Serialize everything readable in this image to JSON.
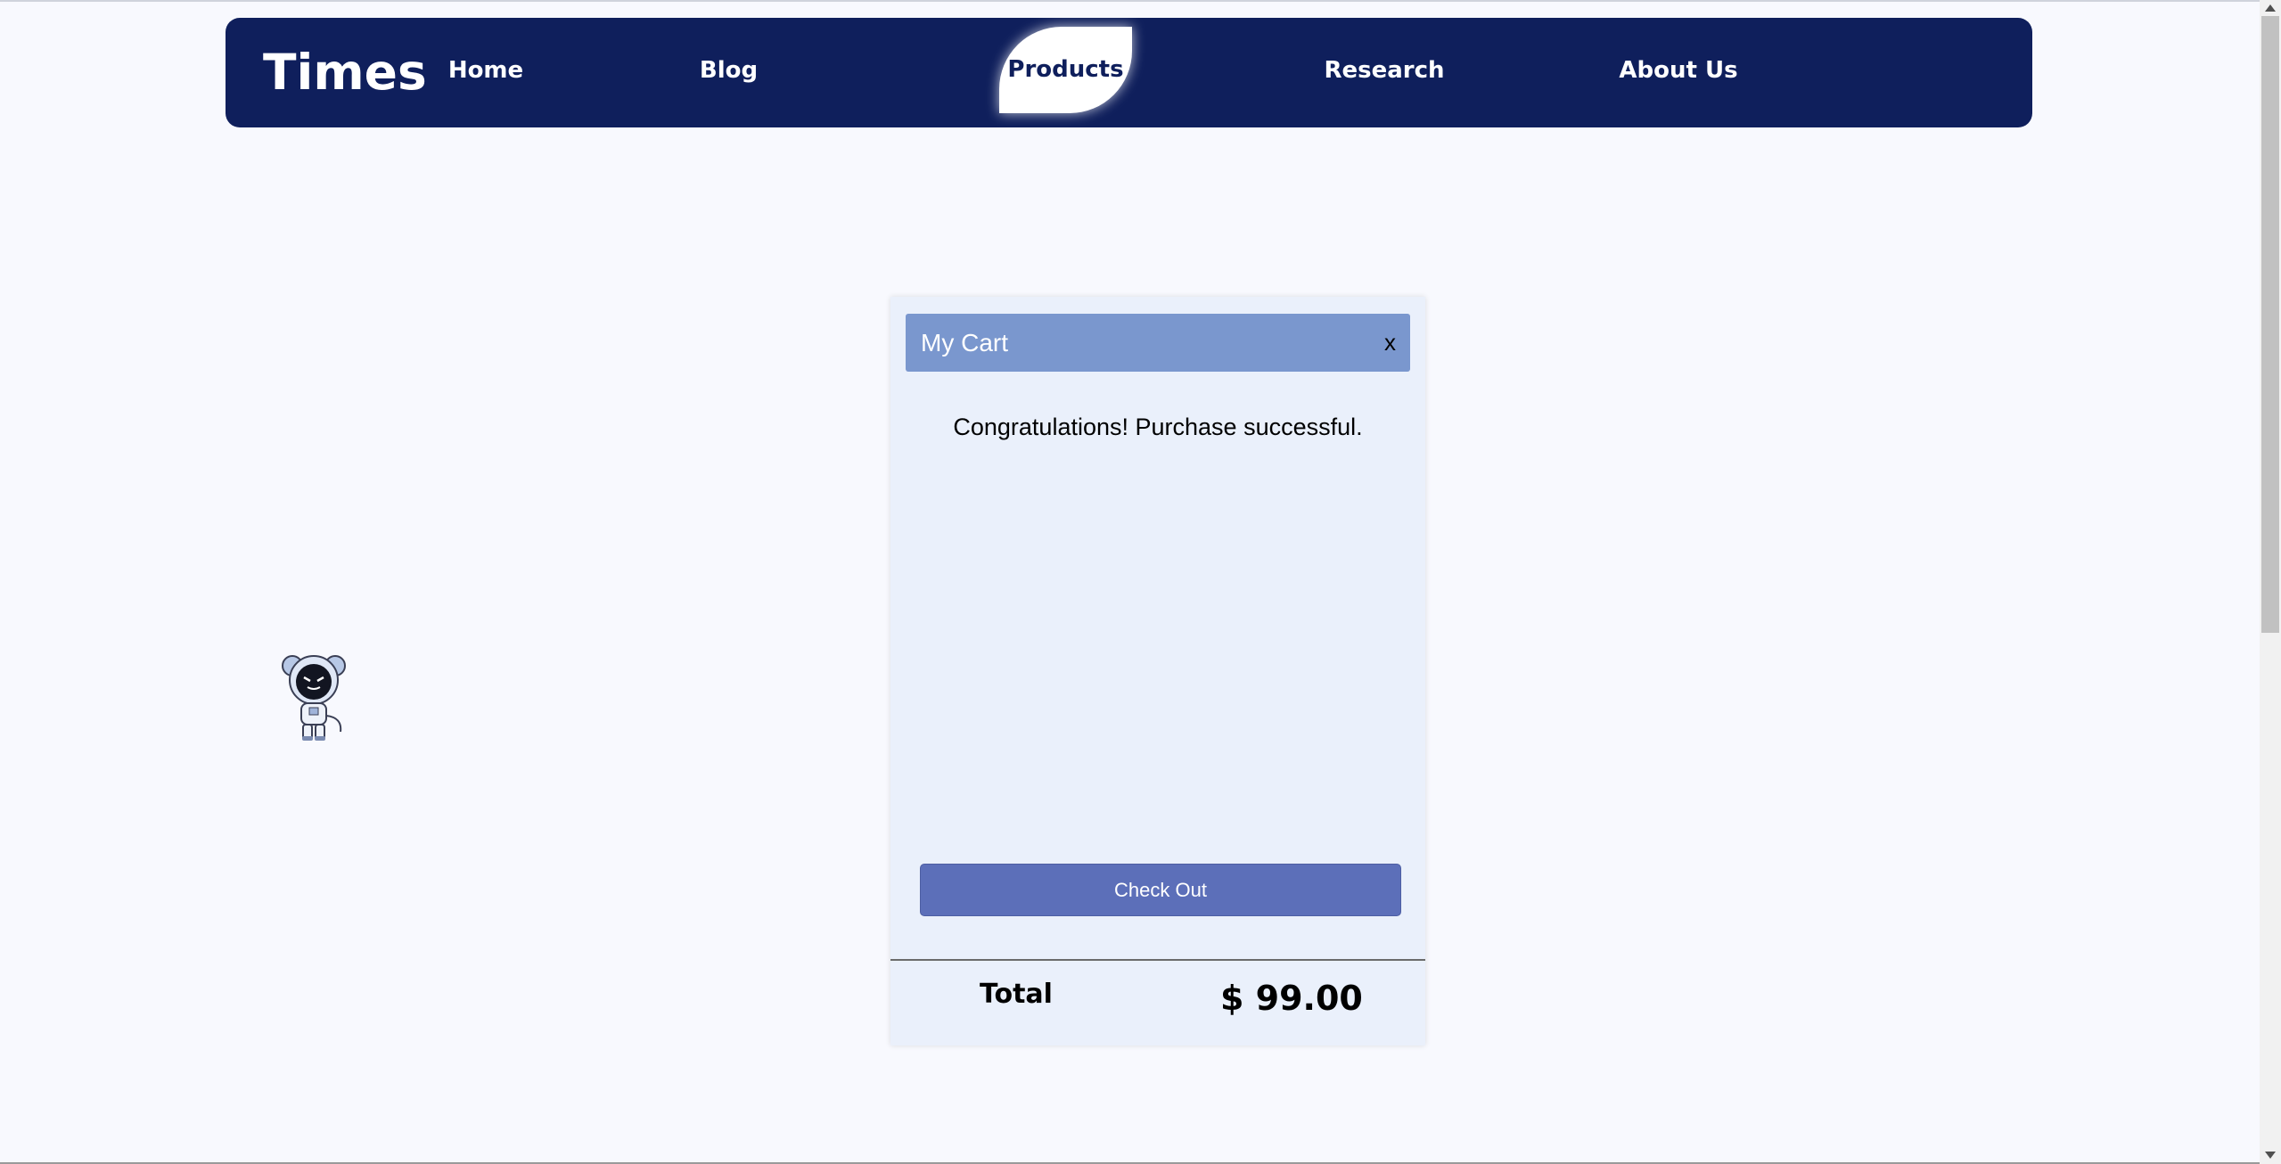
{
  "navbar": {
    "brand": "Times",
    "items": [
      {
        "label": "Home",
        "active": false
      },
      {
        "label": "Blog",
        "active": false
      },
      {
        "label": "Products",
        "active": true
      },
      {
        "label": "Research",
        "active": false
      },
      {
        "label": "About Us",
        "active": false
      }
    ]
  },
  "cart": {
    "title": "My Cart",
    "close_label": "x",
    "message": "Congratulations! Purchase successful.",
    "checkout_label": "Check Out",
    "total_label": "Total",
    "total_value": "$ 99.00"
  },
  "icons": {
    "mascot": "astronaut-mouse-mascot-icon",
    "close": "close-icon"
  },
  "colors": {
    "navbar_bg": "#0f1f5c",
    "cart_header_bg": "#7a97ce",
    "checkout_bg": "#5c6fb9",
    "cart_bg": "#eaf0fb",
    "page_bg": "#f8f9fe"
  }
}
